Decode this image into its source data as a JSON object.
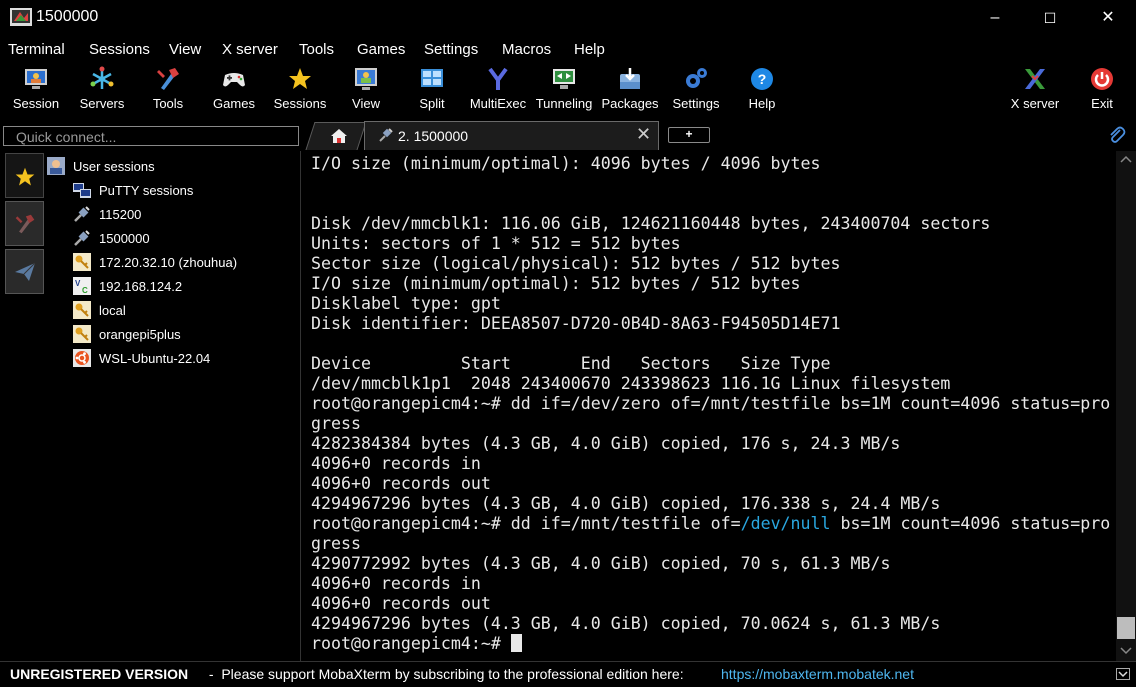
{
  "window": {
    "title": "1500000",
    "min": "–",
    "max": "☐",
    "close": "✕"
  },
  "menu": [
    "Terminal",
    "Sessions",
    "View",
    "X server",
    "Tools",
    "Games",
    "Settings",
    "Macros",
    "Help"
  ],
  "toolbar": {
    "session": "Session",
    "servers": "Servers",
    "tools": "Tools",
    "games": "Games",
    "sessions": "Sessions",
    "view": "View",
    "split": "Split",
    "multiexec": "MultiExec",
    "tunneling": "Tunneling",
    "packages": "Packages",
    "settings": "Settings",
    "help": "Help",
    "xserver": "X server",
    "exit": "Exit"
  },
  "quick_connect": {
    "placeholder": "Quick connect..."
  },
  "tabs": {
    "active_label": "2. 1500000",
    "close": "✕",
    "new": "+"
  },
  "sessions_tree": {
    "root": "User sessions",
    "items": [
      "PuTTY sessions",
      "115200",
      "1500000",
      "172.20.32.10 (zhouhua)",
      "192.168.124.2",
      "local",
      "orangepi5plus",
      "WSL-Ubuntu-22.04"
    ]
  },
  "terminal": {
    "lines": [
      "I/O size (minimum/optimal): 4096 bytes / 4096 bytes",
      "",
      "",
      "Disk /dev/mmcblk1: 116.06 GiB, 124621160448 bytes, 243400704 sectors",
      "Units: sectors of 1 * 512 = 512 bytes",
      "Sector size (logical/physical): 512 bytes / 512 bytes",
      "I/O size (minimum/optimal): 512 bytes / 512 bytes",
      "Disklabel type: gpt",
      "Disk identifier: DEEA8507-D720-0B4D-8A63-F94505D14E71",
      "",
      "Device         Start       End   Sectors   Size Type",
      "/dev/mmcblk1p1  2048 243400670 243398623 116.1G Linux filesystem",
      "root@orangepicm4:~# dd if=/dev/zero of=/mnt/testfile bs=1M count=4096 status=pro",
      "gress",
      "4282384384 bytes (4.3 GB, 4.0 GiB) copied, 176 s, 24.3 MB/s",
      "4096+0 records in",
      "4096+0 records out",
      "4294967296 bytes (4.3 GB, 4.0 GiB) copied, 176.338 s, 24.4 MB/s",
      "",
      "gress",
      "4290772992 bytes (4.3 GB, 4.0 GiB) copied, 70 s, 61.3 MB/s",
      "4096+0 records in",
      "4096+0 records out",
      "4294967296 bytes (4.3 GB, 4.0 GiB) copied, 70.0624 s, 61.3 MB/s",
      ""
    ],
    "line19_pre": "root@orangepicm4:~# dd if=/mnt/testfile of=",
    "line19_path": "/dev/null",
    "line19_post": " bs=1M count=4096 status=pro",
    "prompt": "root@orangepicm4:~# "
  },
  "status": {
    "unregistered": "UNREGISTERED VERSION",
    "message": " -  Please support MobaXterm by subscribing to the professional edition here:",
    "link": "https://mobaxterm.mobatek.net"
  },
  "colors": {
    "accent_blue": "#2aa7e0",
    "link_blue": "#4fb7f0",
    "bg": "#000000"
  }
}
